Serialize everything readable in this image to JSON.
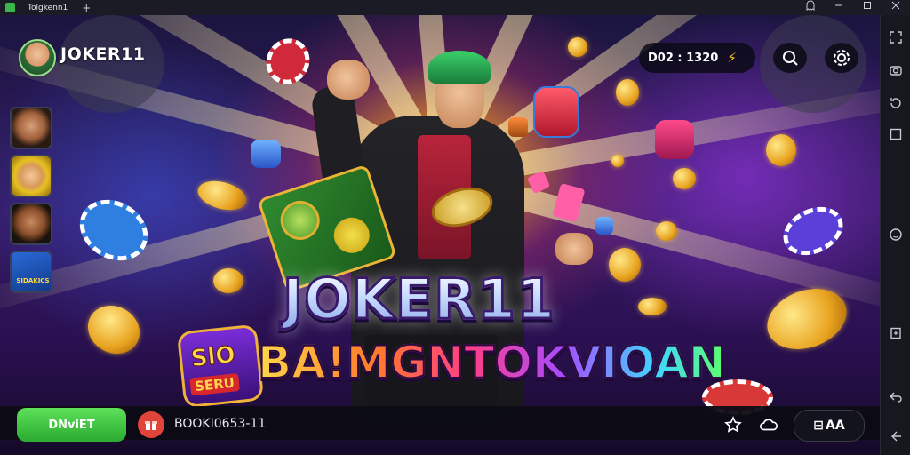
{
  "window": {
    "tab_title": "Tolgkenn1",
    "new_tab_glyph": "+",
    "controls": [
      "ghost-icon",
      "minimize-icon",
      "maximize-icon",
      "close-icon"
    ]
  },
  "header": {
    "brand": "JOKER11",
    "timer": "D02 : 1320",
    "bolt_glyph": "⚡"
  },
  "game_list": [
    "joker-portrait-1",
    "joker-portrait-2",
    "joker-portrait-3",
    "sidekicks-thumb"
  ],
  "game_list_label": "SIDAKICS",
  "hero": {
    "title": "JOKER11",
    "subtitle": "BA!MGNTOKVIOAN",
    "badge_top": "SlO",
    "badge_bottom": "SERU"
  },
  "bottom": {
    "download_label": "DNviET",
    "book_label": "BOOKI0653-11",
    "aa_label": "AA",
    "aa_glyph": "⊟"
  },
  "sidebar_icons": [
    "expand-icon",
    "camera-icon",
    "rotate-icon",
    "square-icon",
    "emoji-icon",
    "screenshot-icon",
    "back-icon",
    "arrow-left-icon"
  ],
  "colors": {
    "accent_green": "#2bab30",
    "hair_green": "#3ad06a",
    "coin_gold": "#e8a21e"
  }
}
